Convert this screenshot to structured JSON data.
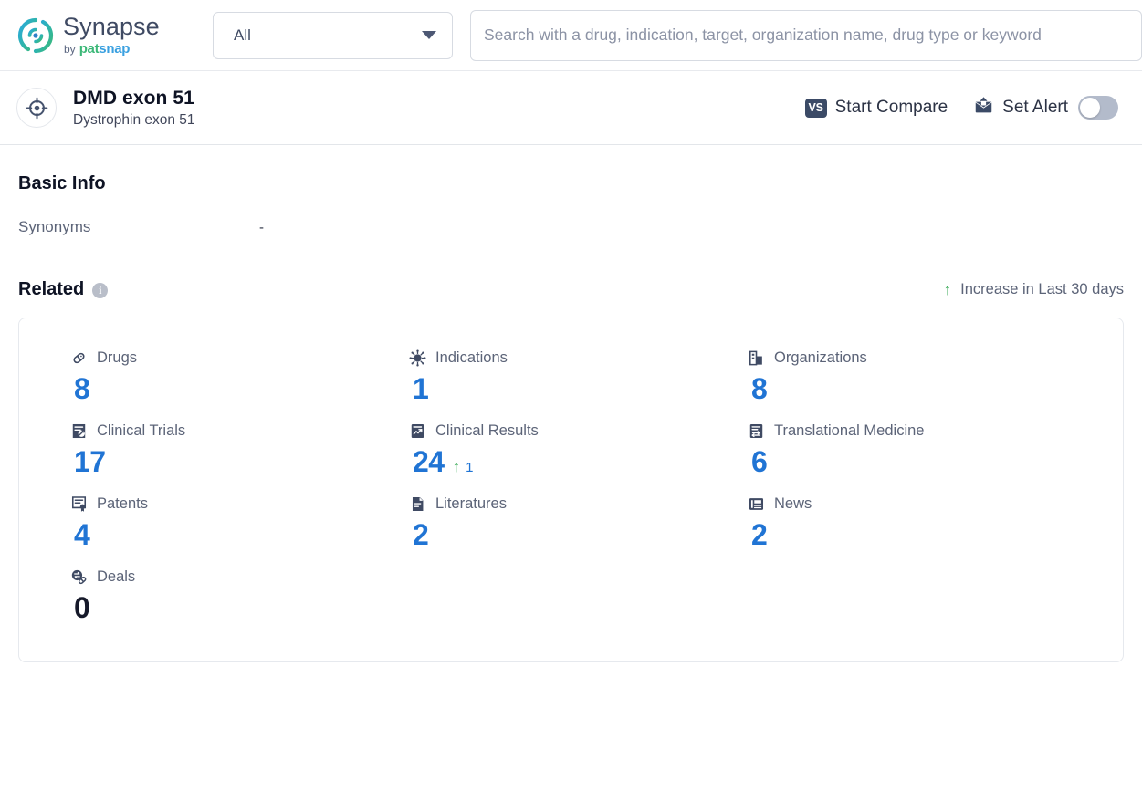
{
  "brand": {
    "title": "Synapse",
    "by": "by",
    "pat": "pat",
    "snap": "snap"
  },
  "search": {
    "scope_value": "All",
    "placeholder": "Search with a drug, indication, target, organization name, drug type or keyword",
    "value": ""
  },
  "entity": {
    "name": "DMD exon 51",
    "alias": "Dystrophin exon 51",
    "compare_label": "Start Compare",
    "compare_badge": "VS",
    "alert_label": "Set Alert",
    "alert_enabled": false
  },
  "basic_info": {
    "heading": "Basic Info",
    "rows": [
      {
        "label": "Synonyms",
        "value": "-"
      }
    ]
  },
  "related": {
    "heading": "Related",
    "legend_arrow": "↑",
    "legend_text": "Increase in Last 30 days",
    "stats": [
      {
        "icon": "pill-icon",
        "label": "Drugs",
        "value": "8",
        "delta": "",
        "zero": false
      },
      {
        "icon": "virus-icon",
        "label": "Indications",
        "value": "1",
        "delta": "",
        "zero": false
      },
      {
        "icon": "building-icon",
        "label": "Organizations",
        "value": "8",
        "delta": "",
        "zero": false
      },
      {
        "icon": "clinical-trial-icon",
        "label": "Clinical Trials",
        "value": "17",
        "delta": "",
        "zero": false
      },
      {
        "icon": "clinical-result-icon",
        "label": "Clinical Results",
        "value": "24",
        "delta": "1",
        "zero": false
      },
      {
        "icon": "translational-icon",
        "label": "Translational Medicine",
        "value": "6",
        "delta": "",
        "zero": false
      },
      {
        "icon": "patent-icon",
        "label": "Patents",
        "value": "4",
        "delta": "",
        "zero": false
      },
      {
        "icon": "literature-icon",
        "label": "Literatures",
        "value": "2",
        "delta": "",
        "zero": false
      },
      {
        "icon": "news-icon",
        "label": "News",
        "value": "2",
        "delta": "",
        "zero": false
      },
      {
        "icon": "deal-icon",
        "label": "Deals",
        "value": "0",
        "delta": "",
        "zero": true
      }
    ]
  },
  "colors": {
    "accent_blue": "#2074d4",
    "increase_green": "#34a853",
    "icon_navy": "#3f4a63",
    "muted_text": "#5c6478"
  }
}
